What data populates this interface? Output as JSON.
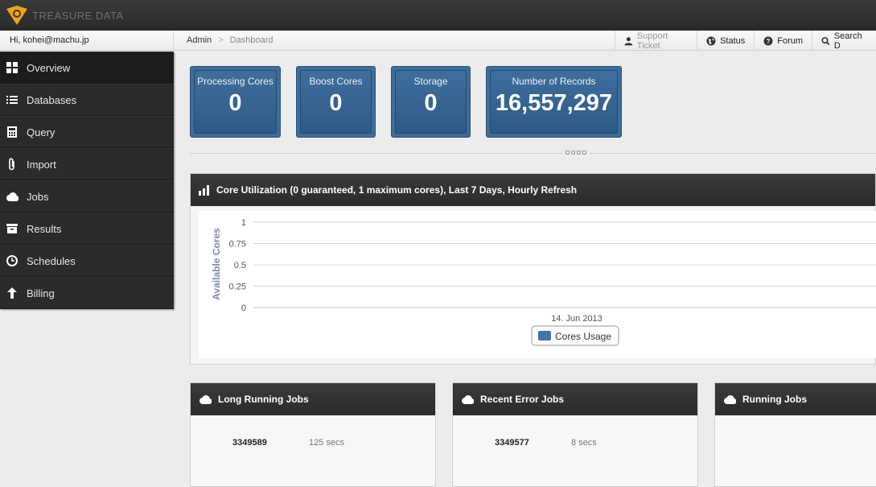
{
  "brand": {
    "name": "TREASURE DATA",
    "accent": "#f0a21a"
  },
  "header": {
    "greeting": "Hi, kohei@machu.jp",
    "breadcrumb": {
      "root": "Admin",
      "separator": ">",
      "current": "Dashboard"
    },
    "links": [
      {
        "icon": "user-icon",
        "label": "Support Ticket"
      },
      {
        "icon": "globe-icon",
        "label": "Status"
      },
      {
        "icon": "help-icon",
        "label": "Forum"
      },
      {
        "icon": "search-icon",
        "label": "Search D"
      }
    ]
  },
  "sidebar": {
    "items": [
      {
        "icon": "grid-icon",
        "label": "Overview",
        "active": true
      },
      {
        "icon": "list-icon",
        "label": "Databases"
      },
      {
        "icon": "calculator-icon",
        "label": "Query"
      },
      {
        "icon": "paperclip-icon",
        "label": "Import"
      },
      {
        "icon": "cloud-icon",
        "label": "Jobs"
      },
      {
        "icon": "archive-icon",
        "label": "Results"
      },
      {
        "icon": "clock-icon",
        "label": "Schedules"
      },
      {
        "icon": "arrow-up-icon",
        "label": "Billing"
      }
    ]
  },
  "stats": [
    {
      "label": "Processing Cores",
      "value": "0"
    },
    {
      "label": "Boost Cores",
      "value": "0"
    },
    {
      "label": "Storage",
      "value": "0"
    },
    {
      "label": "Number of Records",
      "value": "16,557,297"
    }
  ],
  "chart_panel": {
    "title": "Core Utilization (0 guaranteed, 1 maximum cores), Last 7 Days, Hourly Refresh"
  },
  "chart_data": {
    "type": "area",
    "ylabel": "Available Cores",
    "xlabel": "",
    "ylim": [
      0,
      1
    ],
    "yticks": [
      "0",
      "0.25",
      "0.5",
      "0.75",
      "1"
    ],
    "xticks": [
      "14. Jun 2013"
    ],
    "series": [
      {
        "name": "Cores Usage",
        "values": [],
        "color": "#4572a7"
      }
    ],
    "legend": "bottom-center",
    "grid": true
  },
  "job_panels": [
    {
      "title": "Long Running Jobs",
      "rows": [
        {
          "id": "3349589",
          "time": "125 secs"
        }
      ]
    },
    {
      "title": "Recent Error Jobs",
      "rows": [
        {
          "id": "3349577",
          "time": "8 secs"
        }
      ]
    },
    {
      "title": "Running Jobs",
      "rows": []
    }
  ],
  "colors": {
    "stat_blue": "#3f6d9a",
    "series_blue": "#4572a7",
    "header_dark": "#2b2b2b"
  }
}
